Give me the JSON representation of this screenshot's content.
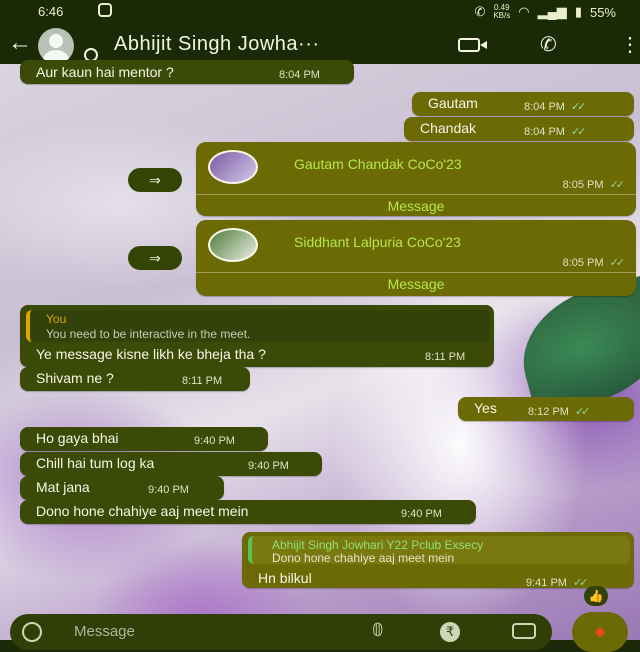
{
  "status_bar": {
    "time": "6:46",
    "net_speed_value": "0.49",
    "net_speed_unit": "KB/s",
    "battery": "55%"
  },
  "header": {
    "contact_name": "Abhijit Singh Jowha···",
    "icons": [
      "back-arrow-icon",
      "video-call-icon",
      "phone-icon",
      "menu-icon"
    ]
  },
  "messages": [
    {
      "text": "Aur kaun hai mentor ?",
      "time": "8:04 PM",
      "dir": "in"
    },
    {
      "text": "Gautam",
      "time": "8:04 PM",
      "dir": "out"
    },
    {
      "text": "Chandak",
      "time": "8:04 PM",
      "dir": "out"
    },
    {
      "contact_card": "Gautam Chandak CoCo'23",
      "time": "8:05 PM",
      "action": "Message",
      "dir": "out"
    },
    {
      "contact_card": "Siddhant Lalpuria CoCo'23",
      "time": "8:05 PM",
      "action": "Message",
      "dir": "out"
    },
    {
      "quote_author": "You",
      "quote_text": "You need to be interactive in the meet.",
      "text": "Ye message kisne likh ke bheja tha ?",
      "time": "8:11 PM",
      "dir": "in"
    },
    {
      "text": "Shivam ne ?",
      "time": "8:11 PM",
      "dir": "in"
    },
    {
      "text": "Yes",
      "time": "8:12 PM",
      "dir": "out"
    },
    {
      "text": "Ho gaya bhai",
      "time": "9:40 PM",
      "dir": "in"
    },
    {
      "text": "Chill hai tum log ka",
      "time": "9:40 PM",
      "dir": "in"
    },
    {
      "text": "Mat jana",
      "time": "9:40 PM",
      "dir": "in"
    },
    {
      "text": "Dono hone chahiye aaj meet mein",
      "time": "9:40 PM",
      "dir": "in"
    },
    {
      "quote_author": "Abhijit Singh Jowhari Y22 Pclub Exsecy",
      "quote_text": "Dono hone chahiye aaj meet mein",
      "text": "Hn bilkul",
      "time": "9:41 PM",
      "dir": "out"
    }
  ],
  "composer": {
    "placeholder": "Message"
  },
  "colors": {
    "header": "#1b2a06",
    "incoming_bubble": "#3b4a06",
    "outgoing_bubble": "#6b6a05",
    "read_ticks": "#8fd9a0",
    "link_text": "#b6e74a"
  }
}
